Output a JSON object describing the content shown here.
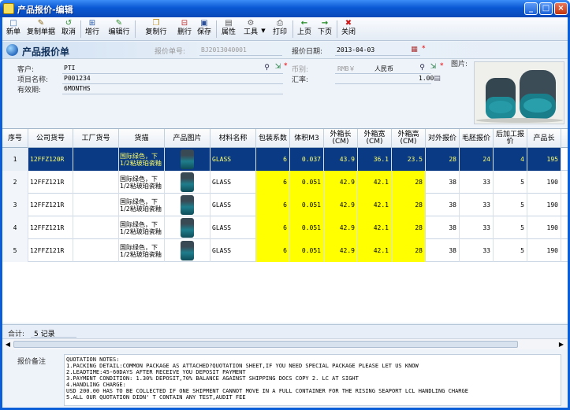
{
  "window": {
    "title": "产品报价-编辑",
    "buttons": [
      "_",
      "□",
      "×"
    ]
  },
  "toolbar": {
    "items": [
      {
        "label": "新单",
        "icon": "new-doc-icon",
        "glyph": "□"
      },
      {
        "label": "复制单据",
        "icon": "copy-doc-icon",
        "glyph": "✎"
      },
      {
        "label": "取消",
        "icon": "undo-icon",
        "glyph": "↺"
      },
      {
        "label": "增行",
        "icon": "add-row-icon",
        "glyph": "⊞"
      },
      {
        "label": "编辑行",
        "icon": "edit-row-icon",
        "glyph": "✎"
      },
      {
        "label": "复制行",
        "icon": "copy-row-icon",
        "glyph": "❐"
      },
      {
        "label": "删行",
        "icon": "delete-row-icon",
        "glyph": "⊟"
      },
      {
        "label": "保存",
        "icon": "save-icon",
        "glyph": "▣"
      },
      {
        "label": "属性",
        "icon": "properties-icon",
        "glyph": "▤"
      },
      {
        "label": "工具",
        "icon": "tools-icon",
        "glyph": "⚙"
      },
      {
        "label": "打印",
        "icon": "print-icon",
        "glyph": "⎙"
      },
      {
        "label": "上页",
        "icon": "prev-page-icon",
        "glyph": "←"
      },
      {
        "label": "下页",
        "icon": "next-page-icon",
        "glyph": "→"
      },
      {
        "label": "关闭",
        "icon": "close-icon",
        "glyph": "✖"
      }
    ]
  },
  "header": {
    "form_title": "产品报价单",
    "quote_no_label": "报价单号:",
    "quote_no_value": "BJ2013040001",
    "date_label": "报价日期:",
    "date_value": "2013-04-03",
    "photo_label": "图片:"
  },
  "form": {
    "customer_label": "客户:",
    "customer_value": "PTI",
    "project_label": "项目名称:",
    "project_value": "P001234",
    "validity_label": "有效期:",
    "validity_value": "6MONTHS",
    "currency_label": "币别:",
    "currency_code": "RMB￥",
    "currency_value": "人民币",
    "rate_label": "汇率:",
    "rate_value": "1.00"
  },
  "grid": {
    "columns": [
      "序号",
      "公司货号",
      "工厂货号",
      "货描",
      "产品图片",
      "材料名称",
      "包装系数",
      "体积M3",
      "外箱长\n(CM)",
      "外箱宽\n(CM)",
      "外箱高\n(CM)",
      "对外报价",
      "毛胚报价",
      "后加工报\n价",
      "产品长"
    ],
    "rows": [
      {
        "seq": "1",
        "company_no": "12FFZ120R",
        "factory_no": "",
        "desc": "国际绿色，下\n1/2粘玻珀瓷釉",
        "material": "GLASS",
        "pack": "6",
        "volume": "0.037",
        "len": "43.9",
        "wid": "36.1",
        "hgt": "23.5",
        "ext_price": "28",
        "blank_price": "24",
        "post_price": "4",
        "prod_len": "195"
      },
      {
        "seq": "2",
        "company_no": "12FFZ121R",
        "factory_no": "",
        "desc": "国际绿色，下\n1/2粘玻珀瓷釉",
        "material": "GLASS",
        "pack": "6",
        "volume": "0.051",
        "len": "42.9",
        "wid": "42.1",
        "hgt": "28",
        "ext_price": "38",
        "blank_price": "33",
        "post_price": "5",
        "prod_len": "190"
      },
      {
        "seq": "3",
        "company_no": "12FFZ121R",
        "factory_no": "",
        "desc": "国际绿色，下\n1/2粘玻珀瓷釉",
        "material": "GLASS",
        "pack": "6",
        "volume": "0.051",
        "len": "42.9",
        "wid": "42.1",
        "hgt": "28",
        "ext_price": "38",
        "blank_price": "33",
        "post_price": "5",
        "prod_len": "190"
      },
      {
        "seq": "4",
        "company_no": "12FFZ121R",
        "factory_no": "",
        "desc": "国际绿色，下\n1/2粘玻珀瓷釉",
        "material": "GLASS",
        "pack": "6",
        "volume": "0.051",
        "len": "42.9",
        "wid": "42.1",
        "hgt": "28",
        "ext_price": "38",
        "blank_price": "33",
        "post_price": "5",
        "prod_len": "190"
      },
      {
        "seq": "5",
        "company_no": "12FFZ121R",
        "factory_no": "",
        "desc": "国际绿色，下\n1/2粘玻珀瓷釉",
        "material": "GLASS",
        "pack": "6",
        "volume": "0.051",
        "len": "42.9",
        "wid": "42.1",
        "hgt": "28",
        "ext_price": "38",
        "blank_price": "33",
        "post_price": "5",
        "prod_len": "190"
      }
    ]
  },
  "summary": {
    "label": "合计:",
    "count": "5 记录"
  },
  "notes": {
    "label": "报价备注",
    "text": "QUOTATION NOTES:\n1.PACKING DETAIL:COMMON PACKAGE AS ATTACHED?QUOTATION SHEET,IF YOU NEED SPECIAL PACKAGE PLEASE LET US KNOW\n2.LEADTIME:45-60DAYS AFTER RECEIVE YOU DEPOSIT PAYMENT\n3.PAYMENT CONDITION: 1.30% DEPOSIT,70% BALANCE AGAINST SHIPPING DOCS COPY 2. LC AT SIGHT\n4.HANDLING CHARGE:\nUSD 200.00 HAS TO BE COLLECTED IF ONE SHIPMENT CANNOT MOVE IN A FULL CONTAINER FOR THE RISING SEAPORT LCL HANDLING CHARGE\n5.ALL OUR QUOTATION DIDN' T CONTAIN ANY TEST,AUDIT FEE"
  },
  "colors": {
    "selected_row": "#0a3a84",
    "highlight_cells": "#ffff00",
    "title_bar": "#0a58d4"
  }
}
